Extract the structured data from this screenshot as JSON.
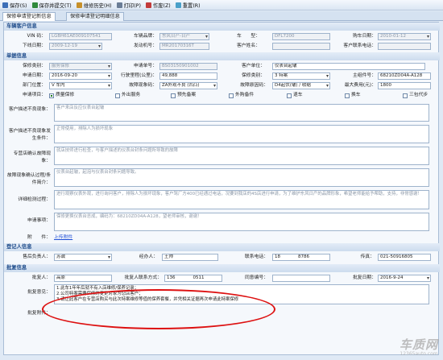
{
  "toolbar": {
    "save": "保存(S)",
    "submit": "保存并提交(T)",
    "history": "维修历史(H)",
    "print": "打印(P)",
    "void": "作废(Z)",
    "reset": "重置(R)"
  },
  "tabs": [
    "保修申请登记新信息",
    "保修申请登记明细信息"
  ],
  "sections": {
    "vehicle": "车辆客户信息",
    "sheet": "单据信息",
    "register": "登记人信息",
    "approval": "批复信息"
  },
  "vehicle": {
    "vin_label": "VIN 码：",
    "vin": "LGBH61AE009107541",
    "brand_label": "车辆品牌：",
    "brand": "东风日产-日产",
    "model_label": "车　　型：",
    "model": "DFL7200",
    "buy_date_label": "购车日期：",
    "buy_date": "2010-01-12",
    "offline_label": "下线日期：",
    "offline": "2009-12-19",
    "engine_label": "发动机号：",
    "engine": "MR20170316T",
    "cust_name_label": "客户姓名：",
    "cust_name": "",
    "cust_phone_label": "客户联系电话：",
    "cust_phone": ""
  },
  "sheet": {
    "type_label": "保修类别：",
    "type": "服务保修",
    "no_label": "申请单号：",
    "no": "BS03150901002",
    "repair_label": "客户单位：",
    "repair": "仪表台起皱",
    "date_label": "申请日期：",
    "date": "2016-09-20",
    "mileage_label": "行驶里程(公里)：",
    "mileage": "49,888",
    "cat_label": "保修类别：",
    "cat": "3 特案",
    "part_label": "主组件号：",
    "part": "68210ZD04A-A128",
    "dept_label": "部门位置：",
    "dept": "V 车内",
    "reason_label": "故障现象码：",
    "reason": "ZA外观不良 (凹凸)",
    "pos_label": "故障原因码：",
    "pos": "D4起伏(皱) / 收缩",
    "max_fee_label": "最大费用(元)：",
    "max_fee": "1800",
    "item_label": "申请项目：",
    "checks": [
      {
        "label": "质量保修",
        "on": true
      },
      {
        "label": "外出服务",
        "on": false
      },
      {
        "label": "预先备案",
        "on": false
      },
      {
        "label": "外购备件",
        "on": false
      },
      {
        "label": "退车",
        "on": false
      },
      {
        "label": "换车",
        "on": false
      },
      {
        "label": "三包代步",
        "on": false
      }
    ]
  },
  "details": [
    {
      "label": "客户描述不良现象：",
      "text": "客户来店反应仪表台起皱"
    },
    {
      "label": "客户描述不良现象发生条件：",
      "text": "正常使用，排除人为损坏现象"
    },
    {
      "label": "专营店确认故障现象：",
      "text": "就店技师进行检查，与客户描述的仪表台封条问题所导致的故障"
    },
    {
      "label": "故障现象确认过程/条件简介：",
      "text": "仪表台起皱，起泡与仪表台封条问题导致。"
    },
    {
      "label": "详细检测过程：",
      "text": "进行观察仪表外观，进行询问客户，排除人为损坏现象，客户驾厂方400已经通过电话，况要到我店的4S店进行申请，为了维护东风日产的品牌形象，希望老师能给予帮助，支持，非常感谢！"
    },
    {
      "label": "申请事项：",
      "text": "保修更换仪表台总成，编码为：68210ZD04A-A128，望老师审核，谢谢！"
    }
  ],
  "attach": {
    "label": "附　　件：",
    "link": "上传附件"
  },
  "register": {
    "sales_label": "售后负责人：",
    "sales": "苏诚",
    "handler_label": "经办人：",
    "handler": "王帅",
    "phone_label": "联系电话：",
    "phone": "18　　　　8786",
    "fax_label": "传真：",
    "fax": "021-50916805"
  },
  "approval": {
    "person_label": "批复人：",
    "person": "高原",
    "contact_label": "批复人联系方式：",
    "contact": "136　　　　0511",
    "same_label": "同意编号：",
    "same": "",
    "date_label": "批复日期：",
    "date": "2016-9-24",
    "opinion_label": "批复意见：",
    "lines": [
      "1.此车1年年后就不有入店维修/保养记录；",
      "2.公司特案需要保修的变更对象为您店客户；",
      "3.请让此客户在专营店购买与此次特案维修等值的保养套餐，并凭相关证据再次申请此特案保修"
    ],
    "attach_label": "批复附件："
  },
  "watermark": {
    "logo": "车质网",
    "url": "12365auto.com"
  },
  "colors": {
    "accent": "#1e4b8a",
    "highlight": "#d11111",
    "link": "#1f4fd6"
  }
}
